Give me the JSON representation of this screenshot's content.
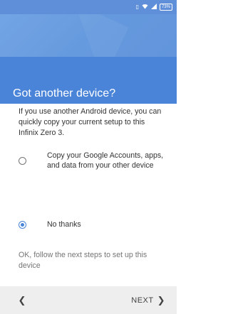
{
  "status_bar": {
    "vibrate_icon": "vibrate-icon",
    "wifi_icon": "wifi-icon",
    "signal_icon": "signal-icon",
    "battery_level": "73%"
  },
  "header": {
    "title": "Got another device?"
  },
  "body": {
    "intro": "If you use another Android device, you can quickly copy your current setup to this Infinix Zero 3.",
    "options": [
      {
        "label": "Copy your Google Accounts, apps, and data from your other device",
        "selected": false
      },
      {
        "label": "No thanks",
        "selected": true
      }
    ],
    "footer_note": "OK, follow the next steps to set up this device"
  },
  "nav": {
    "back_icon": "chevron-left-icon",
    "next_label": "NEXT",
    "next_icon": "chevron-right-icon"
  },
  "colors": {
    "accent": "#4a84d8",
    "status_bar": "#5f8fd8",
    "nav_bar": "#eeeeee"
  }
}
